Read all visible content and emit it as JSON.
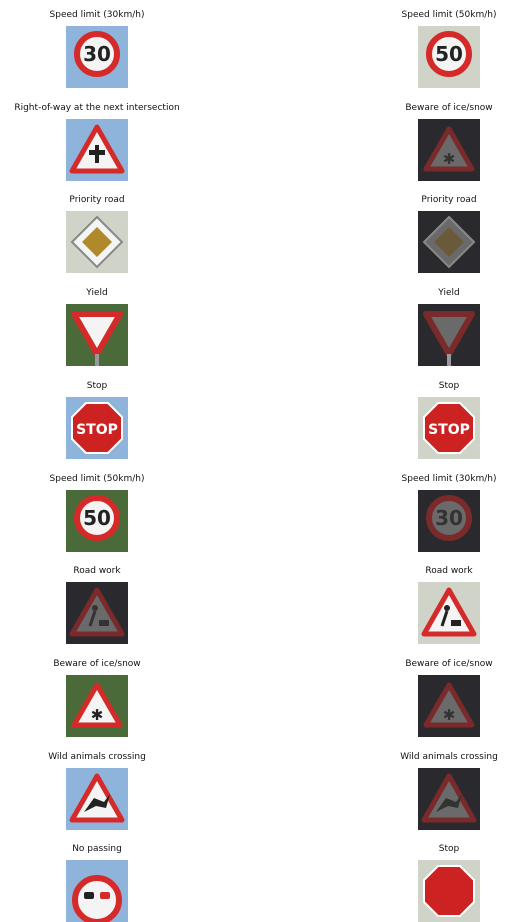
{
  "palette": {
    "sky": "#8fb4dc",
    "dark_bg": "#2a2a2e",
    "foliage": "#4b6a3a",
    "sign_red": "#d42a2a",
    "sign_white": "#f4f4f4",
    "priority_yellow": "#b08a2a"
  },
  "grid": {
    "columns": 2,
    "rows": [
      [
        {
          "label": "Speed limit (30km/h)",
          "icon": "speed-30-sign",
          "bg": "sky",
          "text": "30"
        },
        {
          "label": "Speed limit (50km/h)",
          "icon": "speed-50-sign",
          "bg": "light",
          "text": "50"
        }
      ],
      [
        {
          "label": "Right-of-way at the next intersection",
          "icon": "right-of-way-sign",
          "bg": "sky"
        },
        {
          "label": "Beware of ice/snow",
          "icon": "ice-snow-sign",
          "bg": "dark"
        }
      ],
      [
        {
          "label": "Priority road",
          "icon": "priority-road-sign",
          "bg": "light"
        },
        {
          "label": "Priority road",
          "icon": "priority-road-sign",
          "bg": "dark"
        }
      ],
      [
        {
          "label": "Yield",
          "icon": "yield-sign",
          "bg": "foliage"
        },
        {
          "label": "Yield",
          "icon": "yield-sign",
          "bg": "dark"
        }
      ],
      [
        {
          "label": "Stop",
          "icon": "stop-sign",
          "bg": "sky",
          "text": "STOP"
        },
        {
          "label": "Stop",
          "icon": "stop-sign",
          "bg": "light",
          "text": "STOP"
        }
      ],
      [
        {
          "label": "Speed limit (50km/h)",
          "icon": "speed-50-sign",
          "bg": "foliage",
          "text": "50"
        },
        {
          "label": "Speed limit (30km/h)",
          "icon": "speed-30-sign",
          "bg": "dark",
          "text": "30"
        }
      ],
      [
        {
          "label": "Road work",
          "icon": "road-work-sign",
          "bg": "dark"
        },
        {
          "label": "Road work",
          "icon": "road-work-sign",
          "bg": "light"
        }
      ],
      [
        {
          "label": "Beware of ice/snow",
          "icon": "ice-snow-sign",
          "bg": "foliage"
        },
        {
          "label": "Beware of ice/snow",
          "icon": "ice-snow-sign",
          "bg": "dark"
        }
      ],
      [
        {
          "label": "Wild animals crossing",
          "icon": "wild-animals-sign",
          "bg": "sky"
        },
        {
          "label": "Wild animals crossing",
          "icon": "wild-animals-sign",
          "bg": "dark"
        }
      ],
      [
        {
          "label": "No passing",
          "icon": "no-passing-sign",
          "bg": "sky"
        },
        {
          "label": "Stop",
          "icon": "stop-sign",
          "bg": "light"
        }
      ]
    ]
  }
}
